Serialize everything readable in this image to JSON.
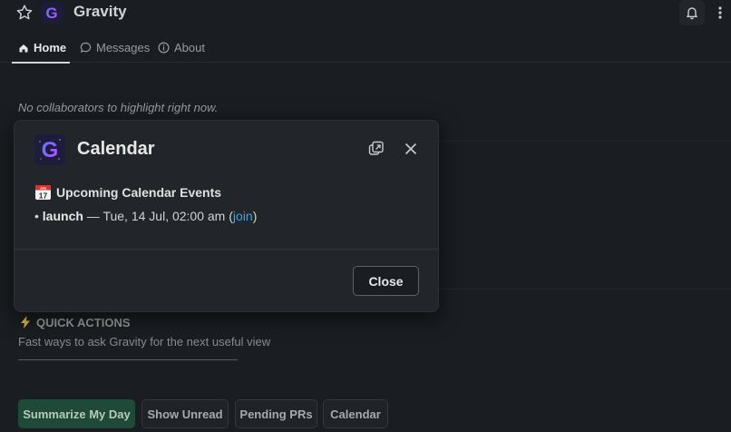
{
  "header": {
    "app_name": "Gravity",
    "logo_letter": "G"
  },
  "tabs": [
    {
      "label": "Home",
      "icon": "home-icon",
      "active": true
    },
    {
      "label": "Messages",
      "icon": "message-bubble-icon",
      "active": false
    },
    {
      "label": "About",
      "icon": "info-icon",
      "active": false
    }
  ],
  "home": {
    "empty_note": "No collaborators to highlight right now.",
    "quick_actions": {
      "heading": "QUICK ACTIONS",
      "icon": "lightning-icon",
      "subtitle": "Fast ways to ask Gravity for the next useful view",
      "buttons": [
        "Summarize My Day",
        "Show Unread",
        "Pending PRs",
        "Calendar"
      ]
    }
  },
  "modal": {
    "title": "Calendar",
    "logo_letter": "G",
    "events_heading": "Upcoming Calendar Events",
    "calendar_emoji_month": "July",
    "calendar_emoji_day": "17",
    "events": [
      {
        "bullet": "•",
        "name": "launch",
        "dash": " — ",
        "when": "Tue, 14 Jul, 02:00 am",
        "link_open": " (",
        "link_label": "join",
        "link_close": ")"
      }
    ],
    "close_label": "Close"
  },
  "colors": {
    "background": "#1a1d21",
    "modal_background": "#222529",
    "primary_button": "#1f4a37",
    "link": "#4a9fd8",
    "logo_gradient": [
      "#4f7cff",
      "#c24dff"
    ]
  }
}
